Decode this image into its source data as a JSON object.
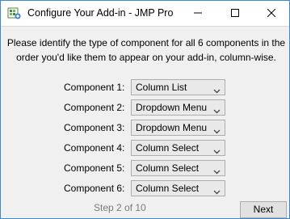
{
  "window": {
    "title": "Configure Your Add-in - JMP Pro"
  },
  "instruction": "Please identify the type of component for all 6 components in the order you'd like them to appear on your add-in, column-wise.",
  "components": [
    {
      "label": "Component 1:",
      "value": "Column List"
    },
    {
      "label": "Component 2:",
      "value": "Dropdown Menu"
    },
    {
      "label": "Component 3:",
      "value": "Dropdown Menu"
    },
    {
      "label": "Component 4:",
      "value": "Column Select"
    },
    {
      "label": "Component 5:",
      "value": "Column Select"
    },
    {
      "label": "Component 6:",
      "value": "Column Select"
    }
  ],
  "footer": {
    "step": "Step 2 of 10",
    "next_label": "Next"
  },
  "icons": {
    "app": "jmp-addin-icon",
    "minimize": "minimize-icon",
    "maximize": "maximize-icon",
    "close": "close-icon",
    "dropdown": "chevron-down-icon"
  }
}
